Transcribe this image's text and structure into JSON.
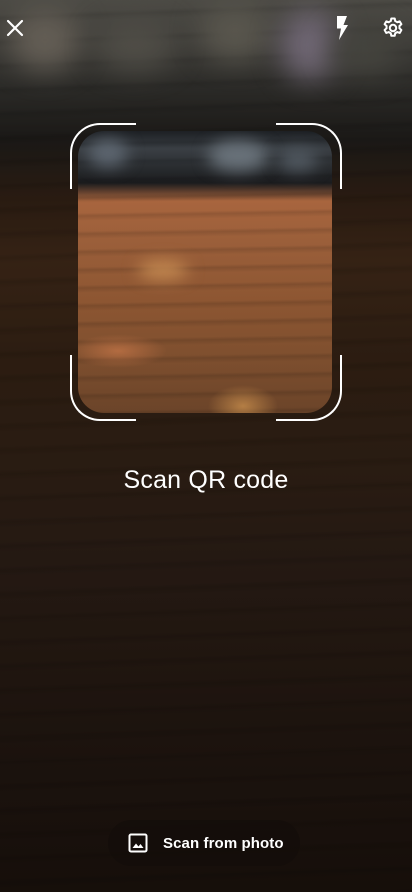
{
  "screen": {
    "title": "Scan QR code"
  },
  "toolbar": {
    "close_icon": "close-icon",
    "flash_icon": "flash-icon",
    "settings_icon": "gear-icon"
  },
  "scanner": {
    "caption": "Scan QR code"
  },
  "bottom_action": {
    "label": "Scan from photo",
    "icon": "image-icon"
  },
  "colors": {
    "foreground": "#ffffff",
    "pill_background": "#140e0a"
  }
}
